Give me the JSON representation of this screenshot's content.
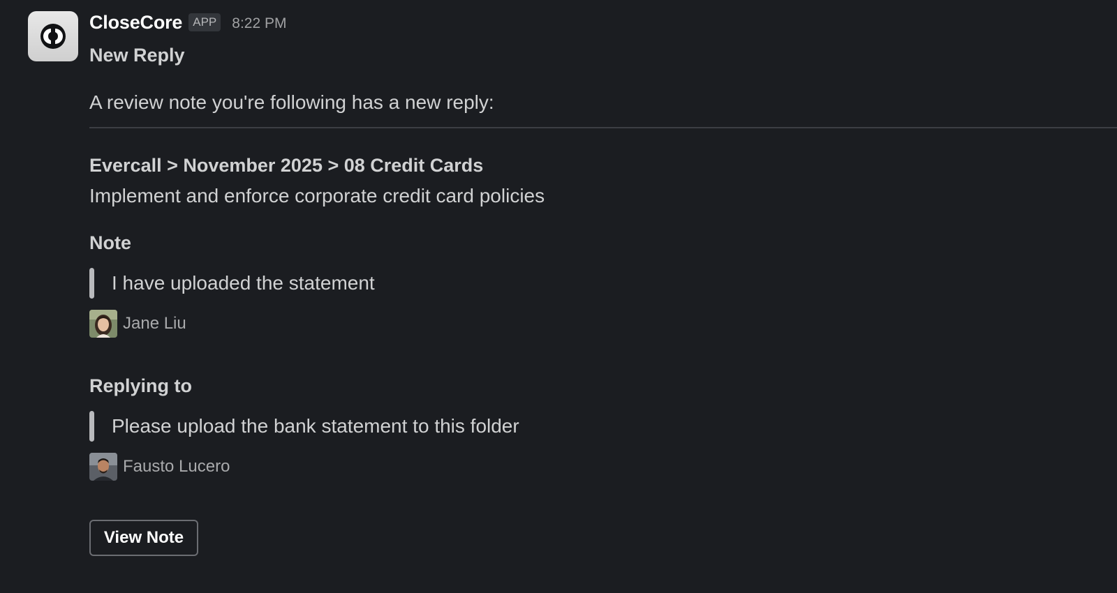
{
  "message": {
    "app_name": "CloseCore",
    "badge": "APP",
    "timestamp": "8:22 PM",
    "title": "New Reply",
    "intro": "A review note you're following has a new reply:",
    "breadcrumb": "Evercall > November 2025 > 08 Credit Cards",
    "task": "Implement and enforce corporate credit card policies",
    "note": {
      "label": "Note",
      "text": "I have uploaded the statement",
      "author": "Jane Liu"
    },
    "replying_to": {
      "label": "Replying to",
      "text": "Please upload the bank statement to this folder",
      "author": "Fausto Lucero"
    },
    "button_label": "View Note"
  },
  "colors": {
    "background": "#1b1d21",
    "text": "#d1d2d3",
    "muted": "#a9aaac",
    "divider": "#3c3e43",
    "quote_bar": "#b9babd"
  },
  "icons": {
    "app_logo": "closecore-logo-icon",
    "note_author_avatar": "jane-liu-avatar",
    "reply_author_avatar": "fausto-lucero-avatar"
  }
}
